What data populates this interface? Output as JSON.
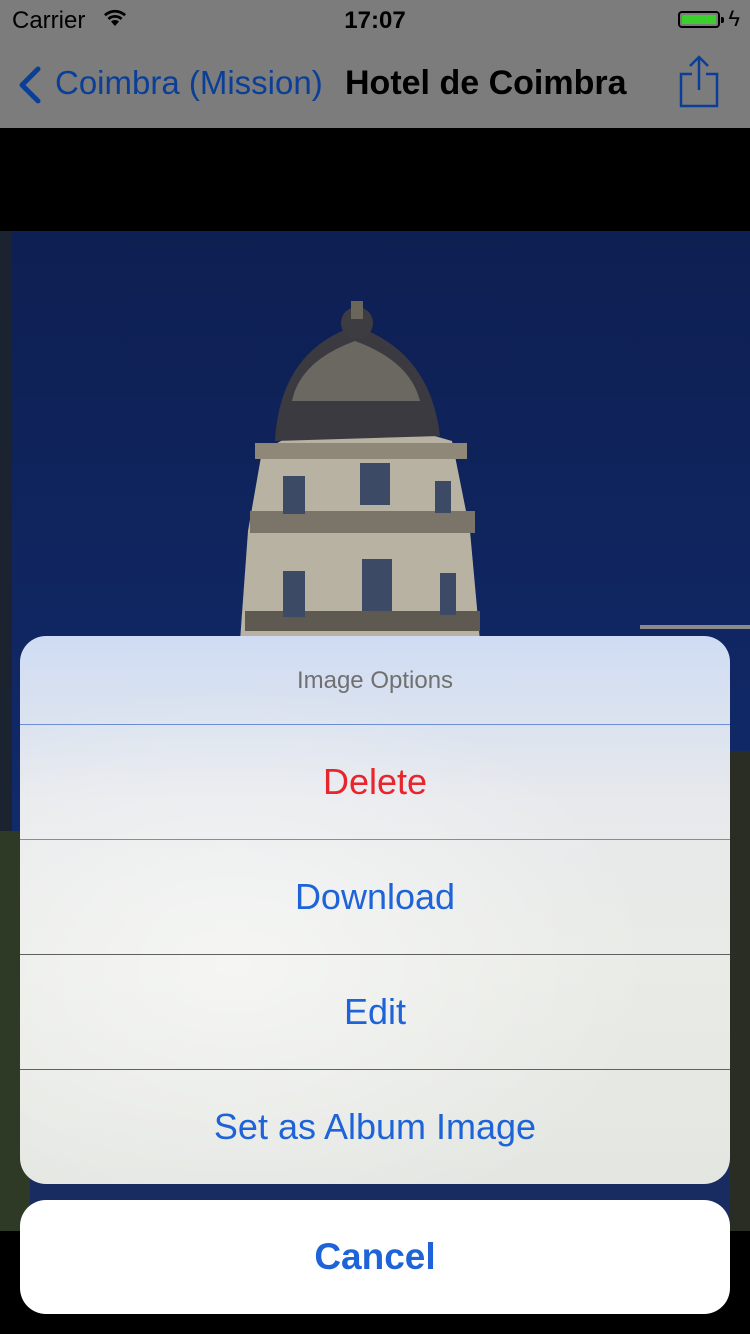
{
  "status_bar": {
    "carrier": "Carrier",
    "time": "17:07",
    "battery_level": 1.0,
    "icons": [
      "wifi-icon",
      "battery-icon",
      "charging-bolt-icon"
    ]
  },
  "nav_bar": {
    "back_label": "Coimbra (Mission)",
    "title": "Hotel de Coimbra",
    "icons": [
      "back-chevron-icon",
      "share-icon"
    ]
  },
  "action_sheet": {
    "title": "Image Options",
    "items": [
      {
        "label": "Delete",
        "style": "destructive"
      },
      {
        "label": "Download",
        "style": "default"
      },
      {
        "label": "Edit",
        "style": "default"
      },
      {
        "label": "Set as Album Image",
        "style": "default"
      }
    ],
    "cancel_label": "Cancel"
  },
  "colors": {
    "accent": "#1e64d8",
    "destructive": "#e8242c",
    "nav_bar_dimmed": "#7c7c7c",
    "back_label_dimmed": "#0b3f97"
  }
}
